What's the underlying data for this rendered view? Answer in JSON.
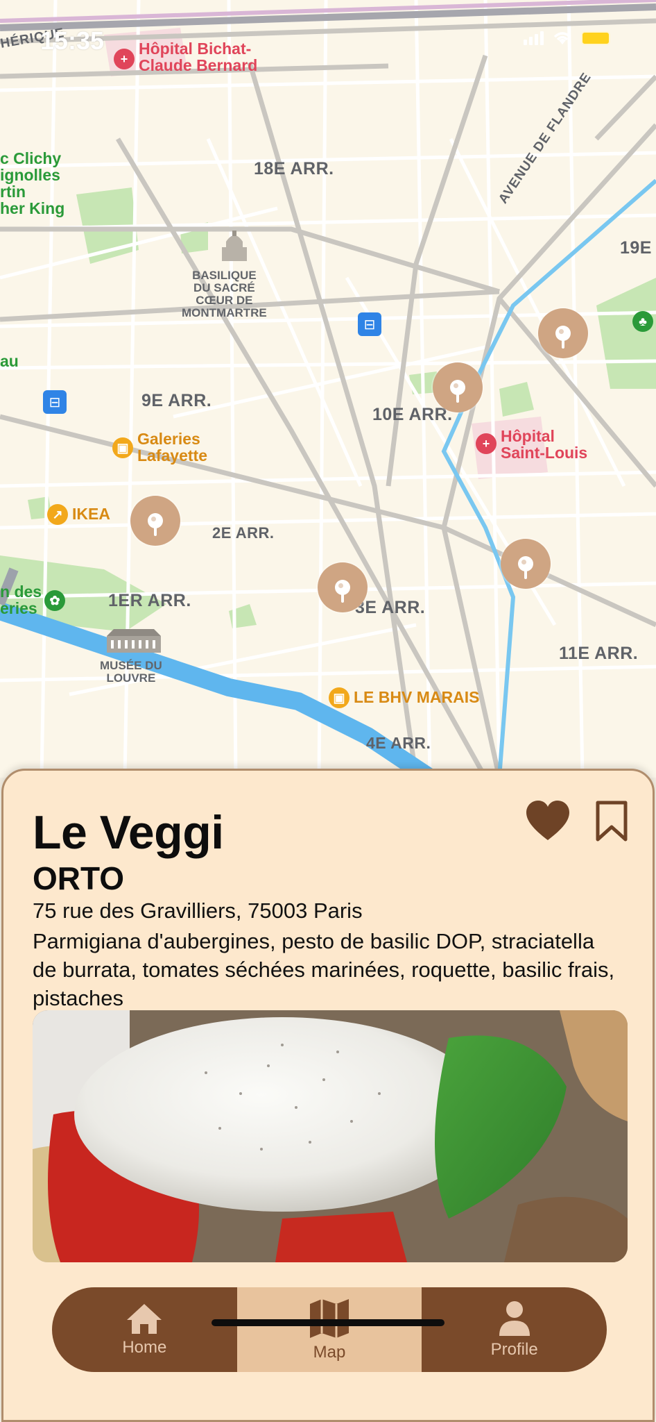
{
  "status_bar": {
    "time": "15:35"
  },
  "map": {
    "districts": [
      "18E ARR.",
      "9E ARR.",
      "10E ARR.",
      "19E",
      "2E ARR.",
      "1ER ARR.",
      "3E ARR.",
      "11E ARR.",
      "4E ARR."
    ],
    "pois": {
      "hopital_bichat": "Hôpital Bichat-\nClaude Bernard",
      "hopital_saint_louis": "Hôpital\nSaint-Louis",
      "galeries": "Galeries\nLafayette",
      "ikea": "IKEA",
      "bhv": "LE BHV MARAIS",
      "clichy": "c Clichy\nignolles\nrtin\nher King",
      "jardin": "n des\neries",
      "bau": "au"
    },
    "landmarks": {
      "sacre_coeur": "BASILIQUE\nDU SACRÉ\nCŒUR DE\nMONTMARTRE",
      "louvre": "MUSÉE DU\nLOUVRE"
    },
    "streets": {
      "flandre": "AVENUE DE FLANDRE",
      "herique": "HÉRIQUE"
    }
  },
  "card": {
    "category": "Le Veggi",
    "restaurant": "ORTO",
    "address": "75 rue des Gravilliers, 75003 Paris",
    "description": "Parmigiana d'aubergines, pesto de basilic DOP, straciatella de burrata, tomates séchées marinées, roquette, basilic frais, pistaches"
  },
  "tabs": [
    {
      "label": "Home",
      "icon": "house-icon",
      "active": false
    },
    {
      "label": "Map",
      "icon": "map-icon",
      "active": true
    },
    {
      "label": "Profile",
      "icon": "person-icon",
      "active": false
    }
  ],
  "colors": {
    "pin": "#cfa583",
    "sheet_background": "#fde8cd",
    "tabbar": "#7a4a2a",
    "tab_active": "#e8c39d",
    "icon_brown": "#6e4326"
  }
}
